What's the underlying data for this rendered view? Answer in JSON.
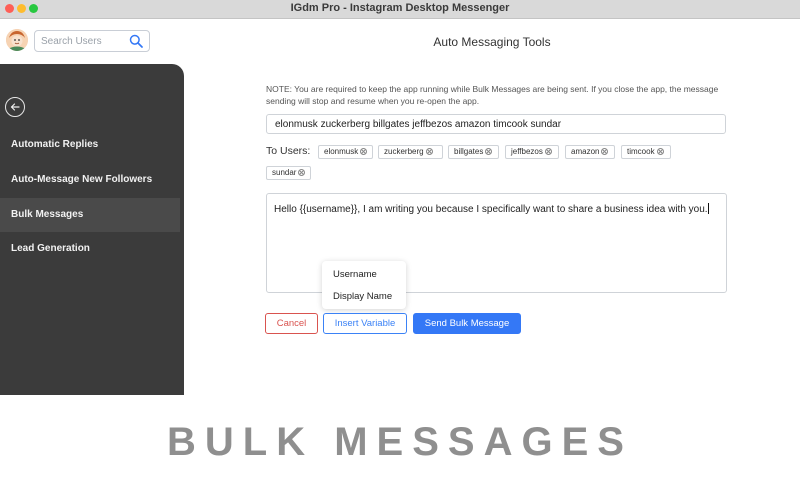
{
  "window": {
    "title": "IGdm Pro - Instagram Desktop Messenger"
  },
  "search": {
    "placeholder": "Search Users",
    "icon": "search-icon"
  },
  "header": {
    "title": "Auto Messaging Tools"
  },
  "sidebar": {
    "back_icon": "arrow-left-icon",
    "items": [
      {
        "label": "Automatic Replies",
        "active": false
      },
      {
        "label": "Auto-Message New Followers",
        "active": false
      },
      {
        "label": "Bulk Messages",
        "active": true
      },
      {
        "label": "Lead Generation",
        "active": false
      }
    ]
  },
  "main": {
    "note": "NOTE: You are required to keep the app running while Bulk Messages are being sent. If you close the app, the message sending will stop and resume when you re-open the app.",
    "users_input_value": "elonmusk zuckerberg billgates jeffbezos amazon timcook sundar",
    "to_users_label": "To Users:",
    "users": [
      "elonmusk",
      "zuckerberg",
      "billgates",
      "jeffbezos",
      "amazon",
      "timcook",
      "sundar"
    ],
    "message": "Hello  {{username}}, I am writing you because I specifically want to share a business idea with you."
  },
  "variable_menu": {
    "items": [
      "Username",
      "Display Name"
    ]
  },
  "buttons": {
    "cancel": "Cancel",
    "insert_variable": "Insert Variable",
    "send": "Send Bulk Message"
  },
  "caption": "BULK MESSAGES",
  "colors": {
    "sidebar_bg": "#3b3b3b",
    "primary": "#3478f6",
    "danger": "#d9534f",
    "caption": "#8f8f8f"
  }
}
